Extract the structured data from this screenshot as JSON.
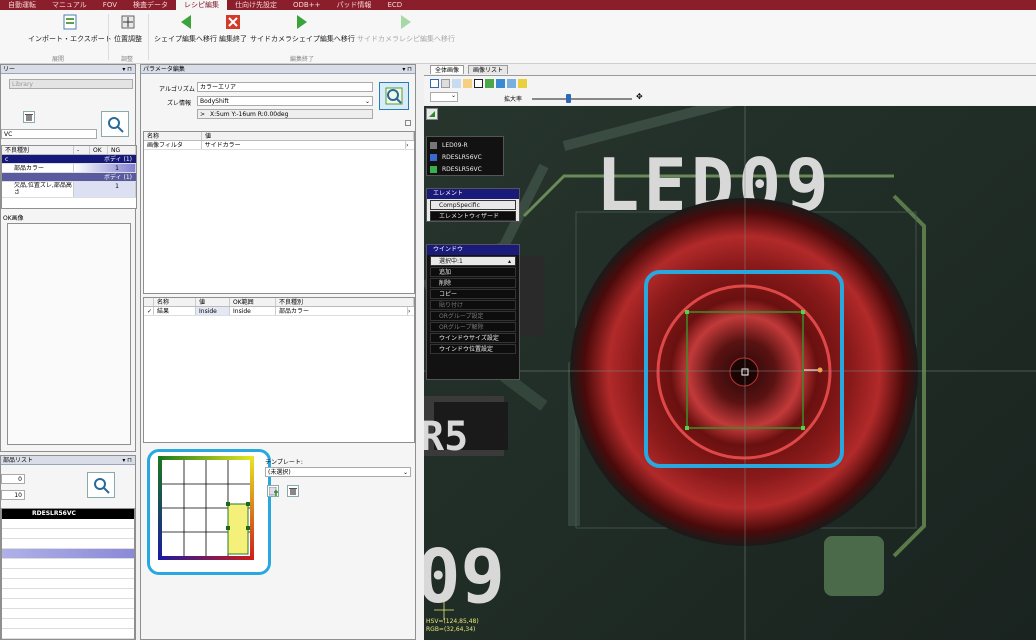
{
  "menubar": {
    "items": [
      "自動運転",
      "マニュアル",
      "FOV",
      "検査データ",
      "レシピ編集",
      "仕向け先設定",
      "ODB++",
      "パッド情報",
      "ECD"
    ],
    "active_index": 4
  },
  "ribbon": {
    "import_export": "インポート・エクスポート",
    "position_adjust": "位置調整",
    "shape_edit_prev": "シェイプ編集へ移行",
    "edit_end": "編集終了",
    "side_camera_shape": "サイドカメラシェイプ編集へ移行",
    "side_camera_recipe": "サイドカメラレシピ編集へ移行",
    "group_expand": "展開",
    "group_adjust": "調整",
    "group_edit_end": "編集終了"
  },
  "left_panel": {
    "title": "リー",
    "library_value": "Library",
    "combo_value": "VC",
    "grid_headers": [
      "不良種別",
      "-",
      "OK",
      "NG"
    ],
    "rows": [
      {
        "c1": "c",
        "c2": "ボディ (1)",
        "kind": "header"
      },
      {
        "c1": "部品カラー",
        "c2": "1",
        "kind": "normal"
      },
      {
        "c1": "",
        "c2": "ボディ (1)",
        "kind": "header2"
      },
      {
        "c1": "欠品,位置ズレ,部品高さ",
        "c2": "1",
        "kind": "normal"
      }
    ],
    "ok_image_label": "OK画像"
  },
  "parts_list": {
    "title": "部品リスト",
    "field1": "0",
    "field2": "10",
    "list_header": "RDESLR56VC"
  },
  "param_panel": {
    "title": "パラメータ編集",
    "algorithm_label": "アルゴリズム",
    "algorithm_value": "カラーエリア",
    "shift_label": "ズレ情報",
    "shift_value": "BodyShift",
    "shift_detail": "X:5um Y:-16um R:0.00deg",
    "grid1_headers": [
      "名称",
      "値"
    ],
    "grid1_rows": [
      [
        "画像フィルタ",
        "サイドカラー"
      ]
    ],
    "grid2_headers": [
      "名称",
      "値",
      "OK範囲",
      "不良種別"
    ],
    "grid2_rows": [
      [
        "結果",
        "Inside",
        "Inside",
        "部品カラー"
      ]
    ],
    "template_label": "テンプレート:",
    "template_value": "(未選択)"
  },
  "image_panel": {
    "tabs": [
      "全体画像",
      "画像リスト"
    ],
    "zoom_label": "拡大率",
    "silkscreen_top": "LED09",
    "silkscreen_bottom": "09",
    "silkscreen_left": "R5",
    "readout_hsv": "HSV=(124,85,48)",
    "readout_rgb": "RGB=(32,64,34)",
    "part_list_overlay": [
      "LED09-R",
      "RDESLR56VC",
      "RDESLR56VC"
    ],
    "element_title": "エレメント",
    "element_items": [
      "CompSpecific",
      "エレメントウィザード"
    ],
    "window_title": "ウインドウ",
    "window_selected": "選択中:1",
    "window_items": [
      "追加",
      "削除",
      "コピー",
      "貼り付け",
      "ORグループ設定",
      "ORグループ解除",
      "ウインドウサイズ設定",
      "ウインドウ位置設定"
    ],
    "window_items_dim": [
      false,
      false,
      false,
      true,
      true,
      true,
      false,
      false
    ]
  },
  "colors": {
    "menubar": "#8a1e2a",
    "highlight_ring": "#29a8e0",
    "selection_frame": "#3b8f2a"
  }
}
